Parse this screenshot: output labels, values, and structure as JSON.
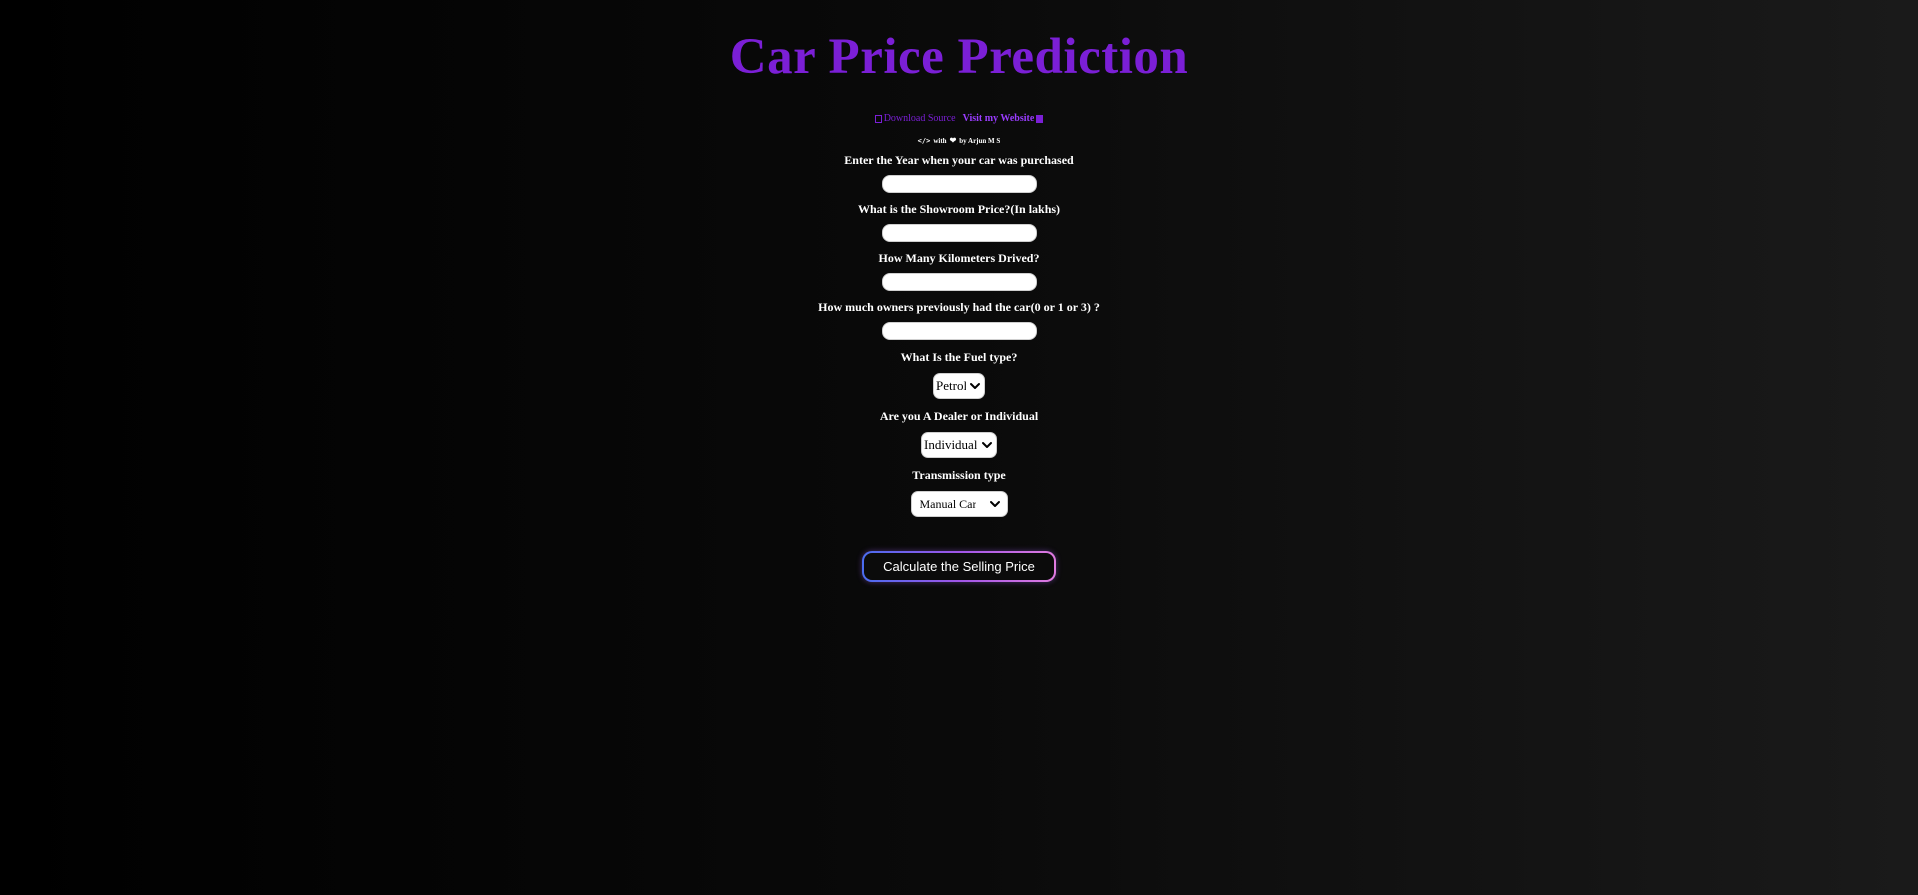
{
  "header": {
    "title": "Car Price Prediction"
  },
  "links": {
    "download_label": "Download Source",
    "website_label": "Visit my Website"
  },
  "credit": {
    "code_symbol": "</>",
    "with": "with",
    "by": "by Arjun M S"
  },
  "form": {
    "year_label": "Enter the Year when your car was purchased",
    "year_value": "",
    "price_label": "What is the Showroom Price?(In lakhs)",
    "price_value": "",
    "km_label": "How Many Kilometers Drived?",
    "km_value": "",
    "owners_label": "How much owners previously had the car(0 or 1 or 3) ?",
    "owners_value": "",
    "fuel_label": "What Is the Fuel type?",
    "fuel_selected": "Petrol",
    "seller_label": "Are you A Dealer or Individual",
    "seller_selected": "Individual",
    "transmission_label": "Transmission type",
    "transmission_selected": "Manual Car",
    "submit_label": "Calculate the Selling Price"
  },
  "colors": {
    "title": "#7b1fd6",
    "background_left": "#000000",
    "background_right": "#1a1a1a"
  }
}
